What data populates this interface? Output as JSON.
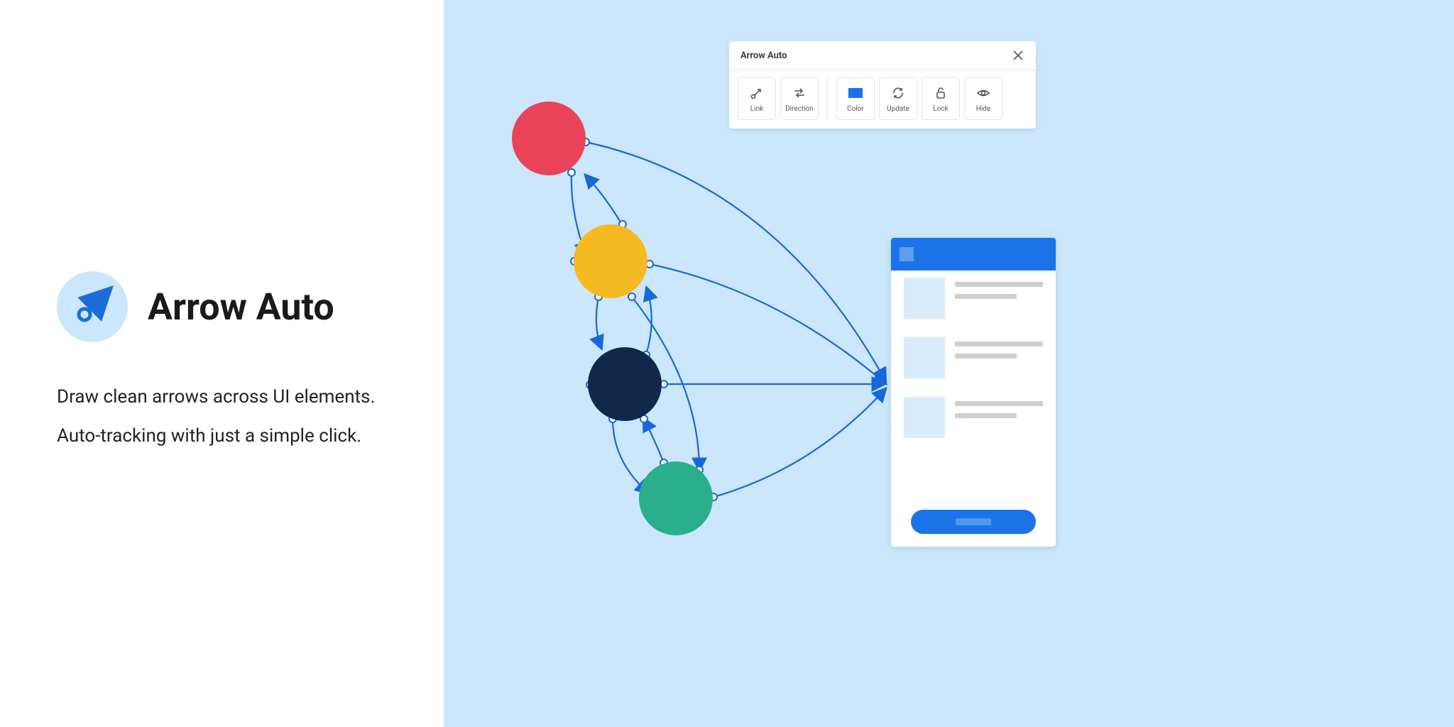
{
  "product": {
    "title": "Arrow Auto",
    "tagline_line1": "Draw clean arrows across UI elements.",
    "tagline_line2": "Auto-tracking with just a simple click."
  },
  "toolbar": {
    "title": "Arrow Auto",
    "buttons": {
      "link": "Link",
      "direction": "Direction",
      "color": "Color",
      "update": "Update",
      "lock": "Lock",
      "hide": "Hide"
    }
  },
  "colors": {
    "accent": "#1a73e8",
    "canvas": "#cce7fb",
    "node_red": "#e9435a",
    "node_yellow": "#f5b921",
    "node_navy": "#11284b",
    "node_teal": "#2aaf8a"
  }
}
